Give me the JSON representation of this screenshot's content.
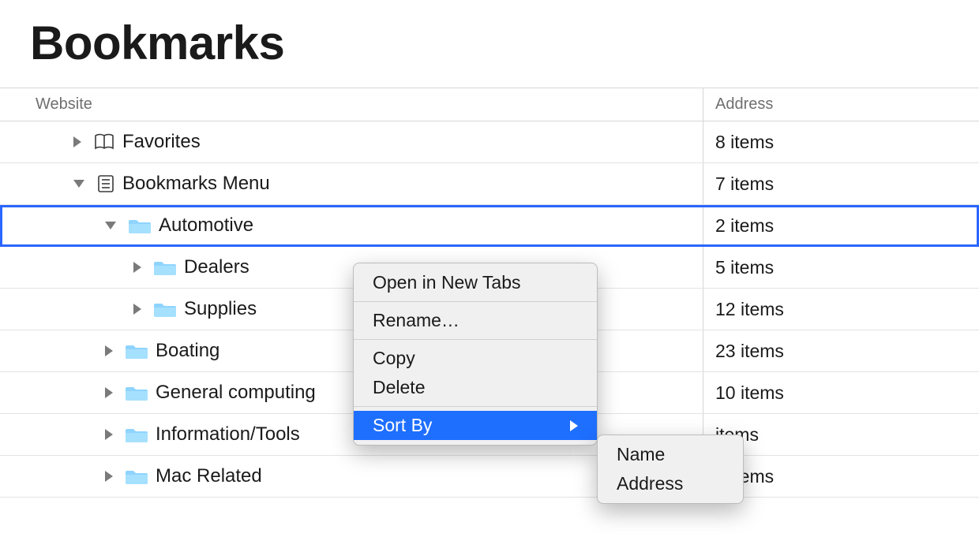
{
  "title": "Bookmarks",
  "columns": {
    "website": "Website",
    "address": "Address"
  },
  "rows": [
    {
      "label": "Favorites",
      "count": "8 items",
      "icon": "book",
      "indent": 0,
      "expanded": false,
      "selected": false
    },
    {
      "label": "Bookmarks Menu",
      "count": "7 items",
      "icon": "list",
      "indent": 0,
      "expanded": true,
      "selected": false
    },
    {
      "label": "Automotive",
      "count": "2 items",
      "icon": "folder",
      "indent": 1,
      "expanded": true,
      "selected": true
    },
    {
      "label": "Dealers",
      "count": "5 items",
      "icon": "folder",
      "indent": 2,
      "expanded": false,
      "selected": false
    },
    {
      "label": "Supplies",
      "count": "12 items",
      "icon": "folder",
      "indent": 2,
      "expanded": false,
      "selected": false
    },
    {
      "label": "Boating",
      "count": "23 items",
      "icon": "folder",
      "indent": 1,
      "expanded": false,
      "selected": false
    },
    {
      "label": "General computing",
      "count": "10 items",
      "icon": "folder",
      "indent": 1,
      "expanded": false,
      "selected": false
    },
    {
      "label": "Information/Tools",
      "count": "items",
      "icon": "folder",
      "indent": 1,
      "expanded": false,
      "selected": false
    },
    {
      "label": "Mac Related",
      "count": "6 items",
      "icon": "folder",
      "indent": 1,
      "expanded": false,
      "selected": false
    }
  ],
  "context_menu": {
    "items": [
      {
        "label": "Open in New Tabs",
        "type": "item"
      },
      {
        "type": "sep"
      },
      {
        "label": "Rename…",
        "type": "item"
      },
      {
        "type": "sep"
      },
      {
        "label": "Copy",
        "type": "item"
      },
      {
        "label": "Delete",
        "type": "item"
      },
      {
        "type": "sep"
      },
      {
        "label": "Sort By",
        "type": "submenu",
        "highlight": true
      }
    ],
    "submenu": [
      {
        "label": "Name"
      },
      {
        "label": "Address"
      }
    ]
  }
}
